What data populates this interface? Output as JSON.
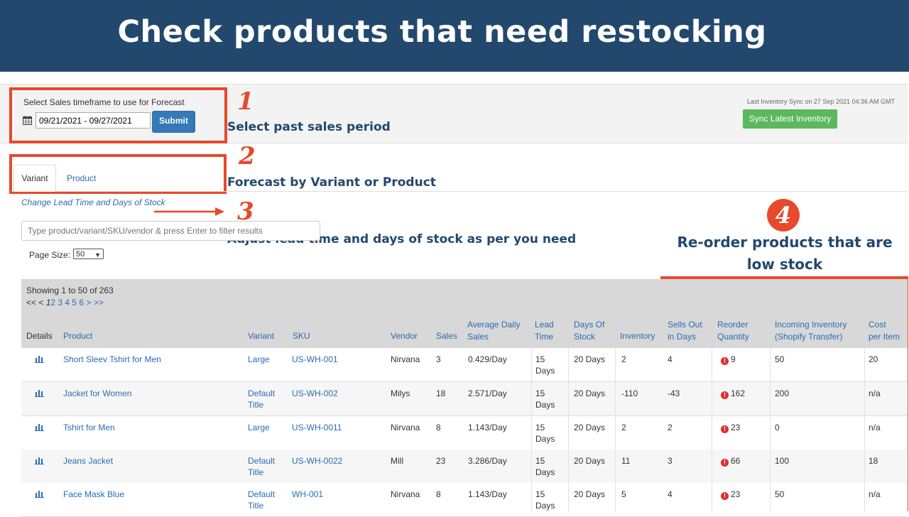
{
  "banner": {
    "title": "Check products that need restocking"
  },
  "forecast_bar": {
    "timeframe_label": "Select Sales timeframe to use for Forecast",
    "date_range": "09/21/2021 - 09/27/2021",
    "submit_label": "Submit",
    "sync_status": "Last Inventory Sync on 27 Sep 2021 04:36 AM GMT",
    "sync_button": "Sync Latest Inventory"
  },
  "tabs": [
    {
      "label": "Variant",
      "active": true
    },
    {
      "label": "Product",
      "active": false
    }
  ],
  "lead_time_link": "Change Lead Time and Days of Stock",
  "filter": {
    "placeholder": "Type product/variant/SKU/vendor & press Enter to filter results"
  },
  "page_size": {
    "label": "Page Size:",
    "value": "50"
  },
  "callouts": {
    "n1": "1",
    "n2": "2",
    "n3": "3",
    "n4": "4",
    "c1": "Select past sales period",
    "c2": "Forecast  by Variant or Product",
    "c3": "Adjust lead time and days of stock as per you need",
    "c4a": "Re-order products that are",
    "c4b": "low stock"
  },
  "table": {
    "showing": "Showing 1 to 50 of 263",
    "pager_prefix": "<< < ",
    "pager_current": "1",
    "pager_pages": "2 3 4 5 6",
    "pager_suffix": " > >>",
    "headers": {
      "details": "Details",
      "product": "Product",
      "variant": "Variant",
      "sku": "SKU",
      "vendor": "Vendor",
      "sales": "Sales",
      "avg1": "Average Daily",
      "avg2": "Sales",
      "lead1": "Lead",
      "lead2": "Time",
      "days1": "Days Of",
      "days2": "Stock",
      "inventory": "Inventory",
      "sells1": "Sells Out",
      "sells2": "in Days",
      "reorder1": "Reorder",
      "reorder2": "Quantity",
      "incoming1": "Incoming Inventory",
      "incoming2": "(Shopify Transfer)",
      "cost1": "Cost",
      "cost2": "per Item"
    },
    "rows": [
      {
        "product": "Short Sleev Tshirt for Men",
        "variant1": "Large",
        "variant2": "",
        "sku": "US-WH-001",
        "vendor": "Nirvana",
        "sales": "3",
        "avg": "0.429/Day",
        "lead1": "15",
        "lead2": "Days",
        "days": "20 Days",
        "inventory": "2",
        "sells": "4",
        "reorder": "9",
        "incoming": "50",
        "cost": "20"
      },
      {
        "product": "Jacket for Women",
        "variant1": "Default",
        "variant2": "Title",
        "sku": "US-WH-002",
        "vendor": "Milys",
        "sales": "18",
        "avg": "2.571/Day",
        "lead1": "15",
        "lead2": "Days",
        "days": "20 Days",
        "inventory": "-110",
        "sells": "-43",
        "reorder": "162",
        "incoming": "200",
        "cost": "n/a"
      },
      {
        "product": "Tshirt for Men",
        "variant1": "Large",
        "variant2": "",
        "sku": "US-WH-0011",
        "vendor": "Nirvana",
        "sales": "8",
        "avg": "1.143/Day",
        "lead1": "15",
        "lead2": "Days",
        "days": "20 Days",
        "inventory": "2",
        "sells": "2",
        "reorder": "23",
        "incoming": "0",
        "cost": "n/a"
      },
      {
        "product": "Jeans Jacket",
        "variant1": "Default",
        "variant2": "Title",
        "sku": "US-WH-0022",
        "vendor": "Mill",
        "sales": "23",
        "avg": "3.286/Day",
        "lead1": "15",
        "lead2": "Days",
        "days": "20 Days",
        "inventory": "11",
        "sells": "3",
        "reorder": "66",
        "incoming": "100",
        "cost": "18"
      },
      {
        "product": "Face Mask  Blue",
        "variant1": "Default",
        "variant2": "Title",
        "sku": "WH-001",
        "vendor": "Nirvana",
        "sales": "8",
        "avg": "1.143/Day",
        "lead1": "15",
        "lead2": "Days",
        "days": "20 Days",
        "inventory": "5",
        "sells": "4",
        "reorder": "23",
        "incoming": "50",
        "cost": "n/a"
      }
    ]
  }
}
